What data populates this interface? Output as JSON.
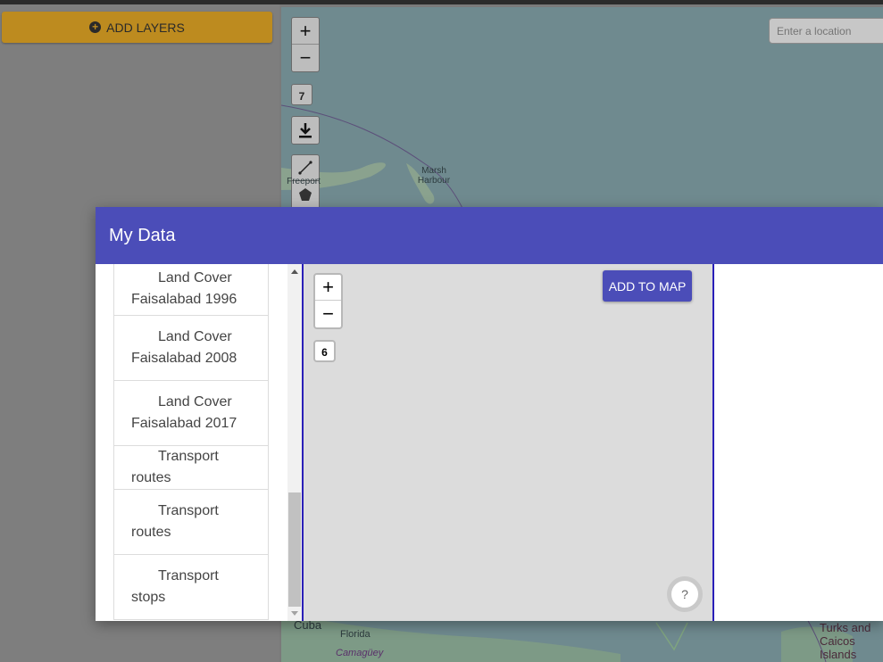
{
  "sidebar": {
    "add_layers_label": "ADD LAYERS",
    "add_layers_icon": "plus-circle-icon"
  },
  "map": {
    "search_placeholder": "Enter a location",
    "zoom_in": "+",
    "zoom_out": "−",
    "zoom_level": "7",
    "labels": {
      "marsh_harbour": "Marsh Harbour",
      "freeport": "Freeport",
      "cuba": "Cuba",
      "florida": "Florida",
      "camaguey": "Camagüey",
      "turks": "Turks and Caicos Islands"
    },
    "land_color": "#7d9a86",
    "water_color": "#6f8a8f"
  },
  "modal": {
    "title": "My Data",
    "header_color": "#4b4db8",
    "layers": [
      {
        "label": "Land Cover Faisalabad 1996"
      },
      {
        "label": "Land Cover Faisalabad 2008"
      },
      {
        "label": "Land Cover Faisalabad 2017"
      },
      {
        "label": "Transport routes"
      },
      {
        "label": "Transport routes"
      },
      {
        "label": "Transport stops"
      }
    ],
    "preview": {
      "zoom_in": "+",
      "zoom_out": "−",
      "zoom_level": "6",
      "add_to_map_label": "ADD TO MAP",
      "help_label": "?"
    }
  }
}
